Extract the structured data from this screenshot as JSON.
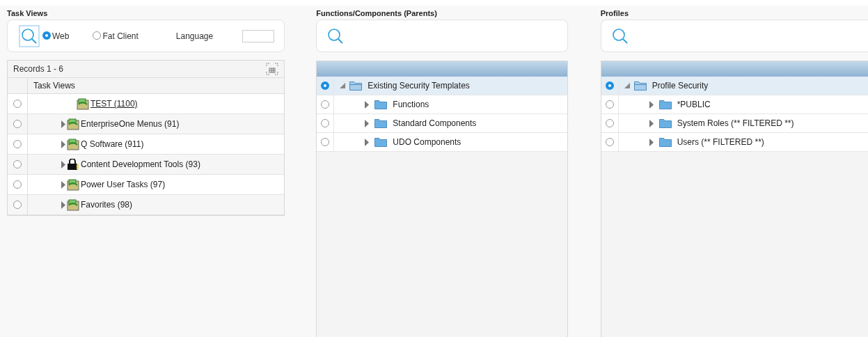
{
  "task_views": {
    "title": "Task Views",
    "view_options": [
      {
        "label": "Web",
        "selected": true
      },
      {
        "label": "Fat Client",
        "selected": false
      }
    ],
    "language": {
      "label": "Language"
    },
    "records": "Records 1 - 6",
    "column": "Task Views",
    "rows": [
      {
        "label": "TEST (1100)",
        "kind": "link",
        "selected": false
      },
      {
        "label": "EnterpriseOne Menus (91)",
        "kind": "task",
        "selected": false
      },
      {
        "label": "Q Software (911)",
        "kind": "task",
        "selected": false
      },
      {
        "label": "Content Development Tools (93)",
        "kind": "locked",
        "selected": false
      },
      {
        "label": "Power User Tasks (97)",
        "kind": "task",
        "selected": false
      },
      {
        "label": "Favorites (98)",
        "kind": "task",
        "selected": false
      }
    ]
  },
  "panels": [
    {
      "title": "Functions/Components (Parents)",
      "tree": [
        {
          "label": "Existing Security Templates",
          "selected": true,
          "expanded": true,
          "children": [
            {
              "label": "Functions",
              "selected": false,
              "expanded": false
            },
            {
              "label": "Standard Components",
              "selected": false,
              "expanded": false
            },
            {
              "label": "UDO Components",
              "selected": false,
              "expanded": false
            }
          ]
        }
      ]
    },
    {
      "title": "Profiles",
      "tree": [
        {
          "label": "Profile Security",
          "selected": true,
          "expanded": true,
          "children": [
            {
              "label": "*PUBLIC",
              "selected": false,
              "expanded": false
            },
            {
              "label": "System Roles (** FILTERED **)",
              "selected": false,
              "expanded": false
            },
            {
              "label": "Users (** FILTERED **)",
              "selected": false,
              "expanded": false
            }
          ]
        }
      ]
    }
  ]
}
